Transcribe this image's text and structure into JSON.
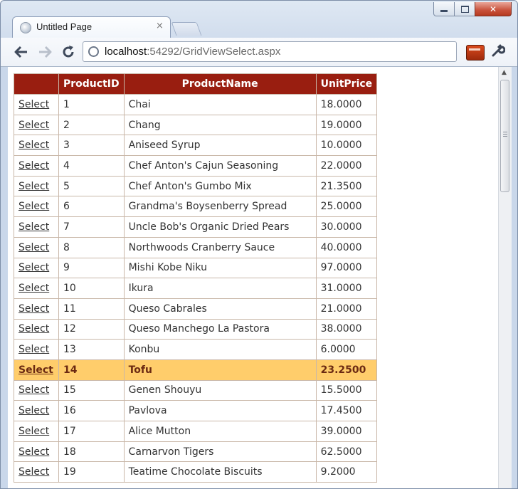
{
  "window": {
    "tab_title": "Untitled Page",
    "tab_close": "×"
  },
  "toolbar": {
    "url_host": "localhost",
    "url_path": ":54292/GridViewSelect.aspx"
  },
  "grid": {
    "columns": [
      "",
      "ProductID",
      "ProductName",
      "UnitPrice"
    ],
    "select_label": "Select",
    "selected_product_id": "14",
    "rows": [
      {
        "id": "1",
        "name": "Chai",
        "price": "18.0000"
      },
      {
        "id": "2",
        "name": "Chang",
        "price": "19.0000"
      },
      {
        "id": "3",
        "name": "Aniseed Syrup",
        "price": "10.0000"
      },
      {
        "id": "4",
        "name": "Chef Anton's Cajun Seasoning",
        "price": "22.0000"
      },
      {
        "id": "5",
        "name": "Chef Anton's Gumbo Mix",
        "price": "21.3500"
      },
      {
        "id": "6",
        "name": "Grandma's Boysenberry Spread",
        "price": "25.0000"
      },
      {
        "id": "7",
        "name": "Uncle Bob's Organic Dried Pears",
        "price": "30.0000"
      },
      {
        "id": "8",
        "name": "Northwoods Cranberry Sauce",
        "price": "40.0000"
      },
      {
        "id": "9",
        "name": "Mishi Kobe Niku",
        "price": "97.0000"
      },
      {
        "id": "10",
        "name": "Ikura",
        "price": "31.0000"
      },
      {
        "id": "11",
        "name": "Queso Cabrales",
        "price": "21.0000"
      },
      {
        "id": "12",
        "name": "Queso Manchego La Pastora",
        "price": "38.0000"
      },
      {
        "id": "13",
        "name": "Konbu",
        "price": "6.0000"
      },
      {
        "id": "14",
        "name": "Tofu",
        "price": "23.2500"
      },
      {
        "id": "15",
        "name": "Genen Shouyu",
        "price": "15.5000"
      },
      {
        "id": "16",
        "name": "Pavlova",
        "price": "17.4500"
      },
      {
        "id": "17",
        "name": "Alice Mutton",
        "price": "39.0000"
      },
      {
        "id": "18",
        "name": "Carnarvon Tigers",
        "price": "62.5000"
      },
      {
        "id": "19",
        "name": "Teatime Chocolate Biscuits",
        "price": "9.2000"
      }
    ]
  },
  "colors": {
    "header_bg": "#991e10",
    "selected_row_bg": "#ffcd6b"
  },
  "icons": {
    "back": "arrow-left",
    "forward": "arrow-right",
    "reload": "reload",
    "page": "globe",
    "extension": "aspx-extension",
    "menu": "wrench"
  }
}
